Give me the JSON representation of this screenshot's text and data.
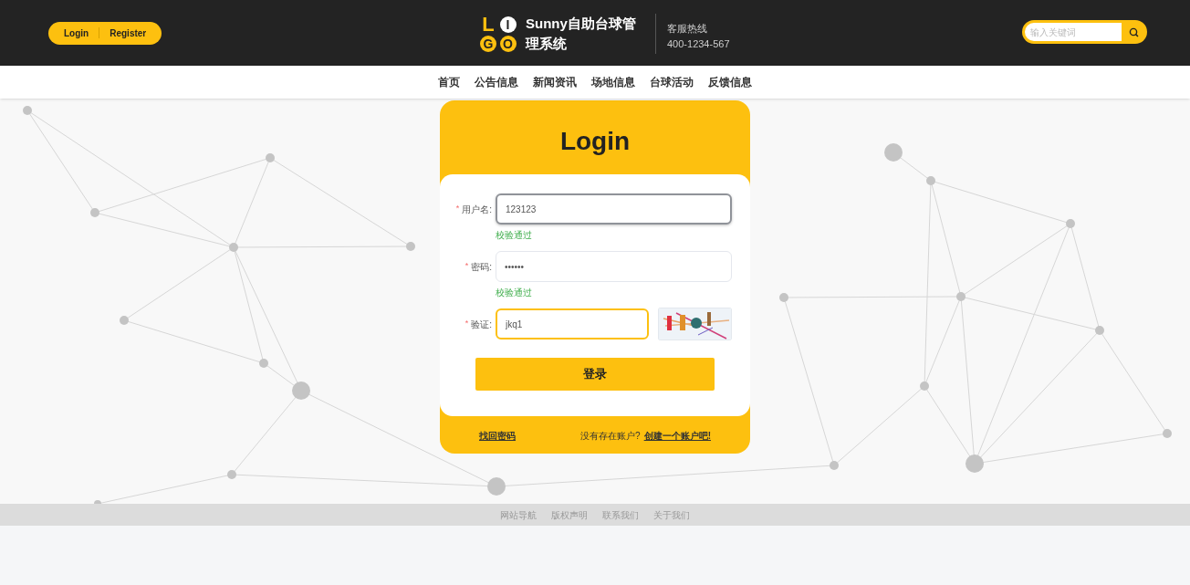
{
  "header": {
    "auth_links": [
      "Login",
      "Register"
    ],
    "logo_letters": [
      "L",
      "I",
      "G",
      "O"
    ],
    "site_title": "Sunny自助台球管理系统",
    "hotline_label": "客服热线",
    "hotline_number": "400-1234-567",
    "search": {
      "placeholder": "输入关键词"
    }
  },
  "nav": [
    {
      "label": "首页"
    },
    {
      "label": "公告信息"
    },
    {
      "label": "新闻资讯"
    },
    {
      "label": "场地信息"
    },
    {
      "label": "台球活动"
    },
    {
      "label": "反馈信息"
    }
  ],
  "login": {
    "title": "Login",
    "fields": [
      {
        "kind": "text",
        "required_mark": "*",
        "label": "用户名:",
        "value": "123123",
        "hovered": true,
        "focused": false,
        "hint": "校验通过"
      },
      {
        "kind": "password",
        "required_mark": "*",
        "label": "密码:",
        "value": "••••••",
        "hovered": false,
        "focused": false,
        "hint": "校验通过"
      },
      {
        "kind": "captcha",
        "required_mark": "*",
        "label": "验证:",
        "value": "jkq1",
        "hovered": false,
        "focused": true
      }
    ],
    "submit": "登录",
    "forgot_link": "找回密码",
    "signup_prompt": "没有存在账户?",
    "signup_link": "创建一个账户吧!"
  },
  "footer": {
    "links": [
      "网站导航",
      "版权声明",
      "联系我们",
      "关于我们"
    ]
  }
}
